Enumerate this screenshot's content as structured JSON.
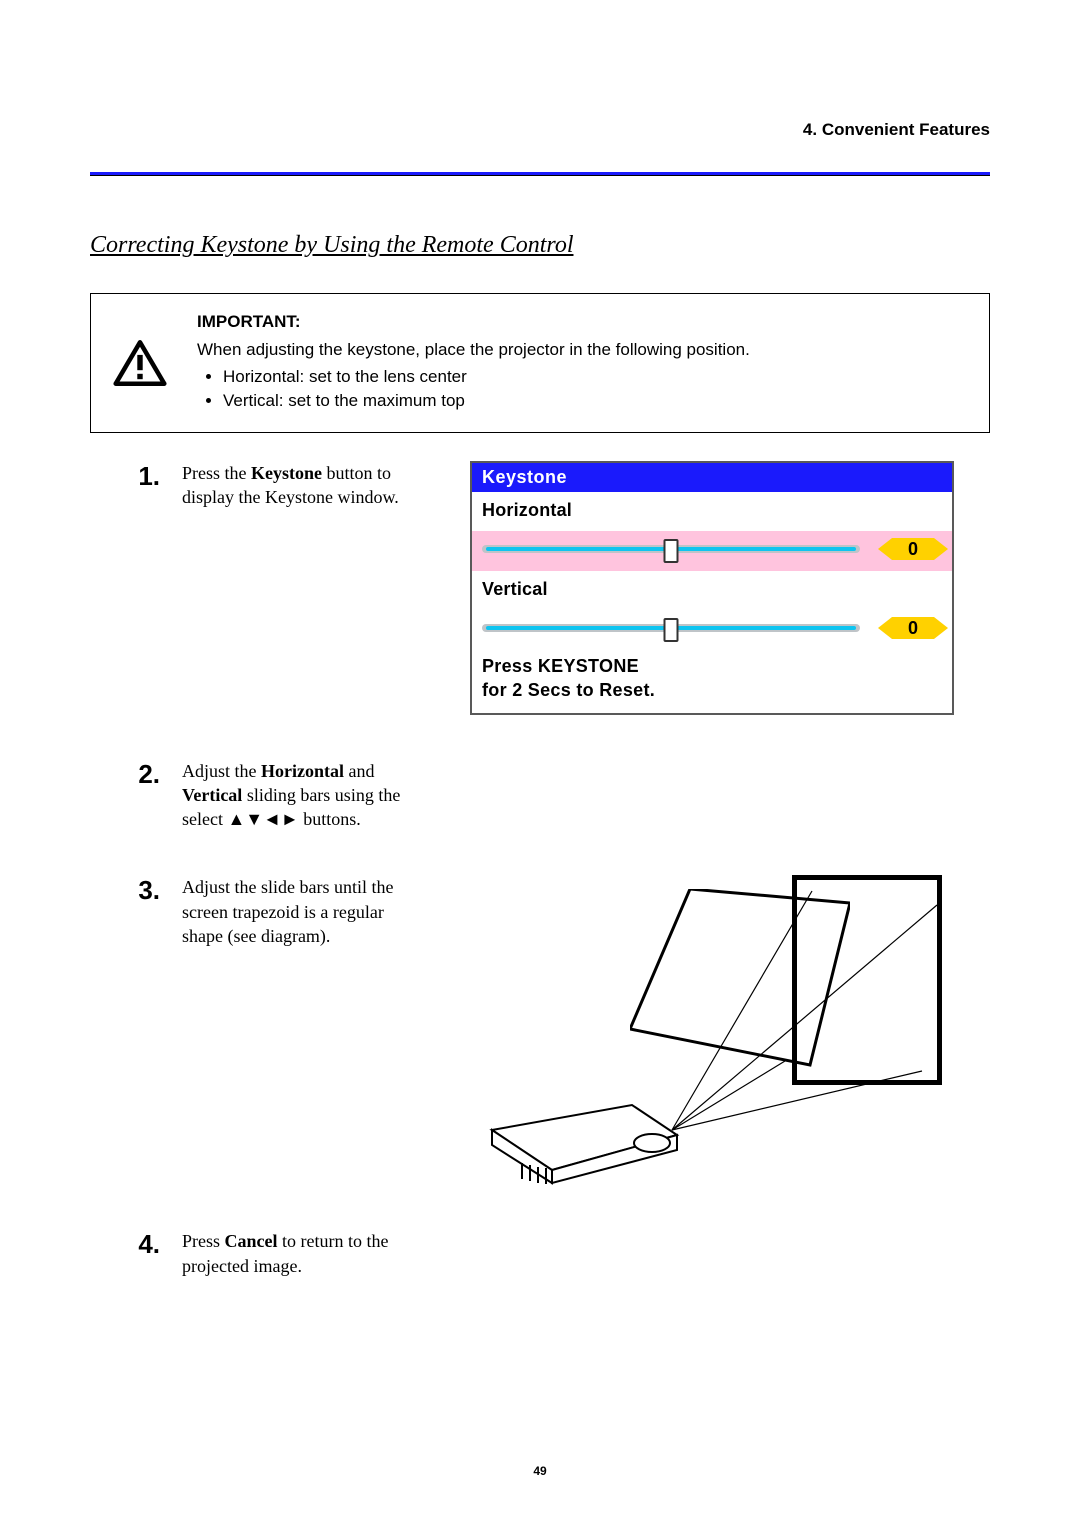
{
  "header": {
    "number": "4.",
    "text": "Convenient Features"
  },
  "section_title": "Correcting Keystone by Using the Remote Control",
  "important": {
    "label": "IMPORTANT:",
    "intro": "When adjusting the keystone, place the projector in the following position.",
    "bullets": [
      "Horizontal: set to the lens center",
      "Vertical: set to the maximum top"
    ]
  },
  "osd": {
    "title": "Keystone",
    "horizontal": {
      "label": "Horizontal",
      "value": "0"
    },
    "vertical": {
      "label": "Vertical",
      "value": "0"
    },
    "footer_line1": "Press KEYSTONE",
    "footer_line2": "for 2 Secs to Reset."
  },
  "steps": {
    "s1": {
      "num": "1.",
      "pre": "Press the ",
      "bold": "Keystone",
      "post": " button to display the Keystone window."
    },
    "s2": {
      "num": "2.",
      "a": "Adjust the ",
      "b": "Horizontal",
      "c": " and ",
      "d": "Vertical",
      "e": " sliding bars using the select ▲▼◄► buttons."
    },
    "s3": {
      "num": "3.",
      "text": "Adjust the slide bars until the screen trapezoid is a regular shape (see diagram)."
    },
    "s4": {
      "num": "4.",
      "a": "Press ",
      "b": "Cancel",
      "c": " to return to the projected image."
    }
  },
  "page_number": "49"
}
